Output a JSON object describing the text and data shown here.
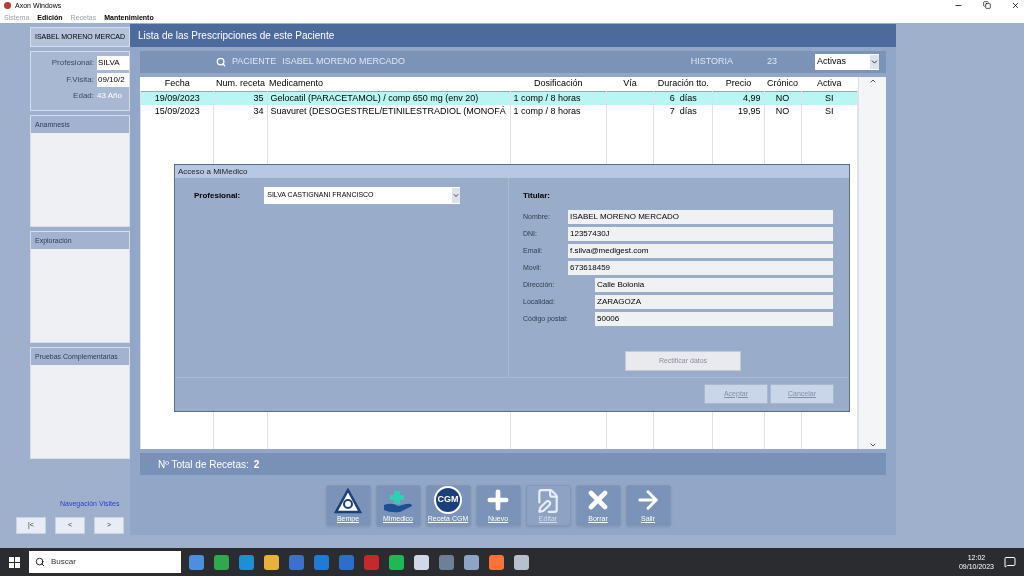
{
  "app_title": "Axon Windows",
  "menu": [
    {
      "label": "Sistema",
      "disabled": true
    },
    {
      "label": "Edición",
      "disabled": false
    },
    {
      "label": "Recetas",
      "disabled": true
    },
    {
      "label": "Mantenimiento",
      "disabled": false
    }
  ],
  "side_panel": {
    "patient": "ISABEL MORENO MERCAD",
    "fields": [
      {
        "label": "Profesional:",
        "value": "SILVA",
        "kind": "input"
      },
      {
        "label": "F.Visita:",
        "value": "09/10/2",
        "kind": "input"
      },
      {
        "label": "Edad:",
        "value": "43 Año",
        "kind": "text"
      }
    ],
    "sections": [
      "Anamnesis",
      "Exploración",
      "Pruebas Complementarias"
    ],
    "nav_label": "Navegación Visites",
    "nav_buttons": [
      "|<",
      "<",
      ">"
    ]
  },
  "window": {
    "title": "Lista de las Prescripciones de este Paciente",
    "patient_label": "PACIENTE",
    "patient_name": "ISABEL MORENO MERCADO",
    "history_label": "HISTORIA",
    "history_value": "23",
    "filter": "Activas",
    "table": {
      "columns": [
        "Fecha",
        "Num. receta",
        "Medicamento",
        "Dosificación",
        "Vía",
        "Duración tto.",
        "Precio",
        "Crónico",
        "Activa"
      ],
      "rows": [
        {
          "selected": true,
          "cells": [
            "19/09/2023",
            "35",
            "Gelocatil (PARACETAMOL) / comp 650 mg (env 20)",
            "1 comp / 8 horas",
            "",
            "6  días",
            "4,99",
            "NO",
            "SI"
          ]
        },
        {
          "selected": false,
          "cells": [
            "15/09/2023",
            "34",
            "Suavuret (DESOGESTREL/ETINILESTRADIOL (MONOFÁ",
            "1 comp / 8 horas",
            "",
            "7  días",
            "19,95",
            "NO",
            "SI"
          ]
        }
      ]
    },
    "total_label": "Nº Total de Recetas:",
    "total_value": "2",
    "toolbar": [
      {
        "label": "Bempe",
        "kind": "triangle",
        "disabled": false
      },
      {
        "label": "Mimedico",
        "kind": "hand",
        "disabled": false
      },
      {
        "label": "Receta CGM",
        "kind": "badge",
        "badge": "CGM",
        "disabled": false
      },
      {
        "label": "Nuevo",
        "kind": "plus",
        "disabled": false
      },
      {
        "label": "Editar",
        "kind": "edit",
        "disabled": true
      },
      {
        "label": "Borrar",
        "kind": "cross",
        "disabled": false
      },
      {
        "label": "Salir",
        "kind": "arrow",
        "disabled": false
      }
    ]
  },
  "dialog": {
    "title": "Acceso a MiMedico",
    "professional_label": "Profesional:",
    "professional_value": "SILVA CASTIGNANI FRANCISCO",
    "holder_label": "Titular:",
    "fields": [
      {
        "label": "Nombre:",
        "value": "ISABEL MORENO MERCADO",
        "kind": "short"
      },
      {
        "label": "DNI:",
        "value": "12357430J",
        "kind": "short"
      },
      {
        "label": "Email:",
        "value": "f.silva@medigest.com",
        "kind": "short"
      },
      {
        "label": "Movil:",
        "value": "673618459",
        "kind": "short"
      },
      {
        "label": "Dirección:",
        "value": "Calle Bolonia",
        "kind": "long"
      },
      {
        "label": "Localidad:",
        "value": "ZARAGOZA",
        "kind": "long"
      },
      {
        "label": "Código postal:",
        "value": "50006",
        "kind": "long"
      }
    ],
    "rectify": {
      "label": "Rectificar datos",
      "disabled": true
    },
    "buttons": [
      {
        "label": "Aceptar",
        "disabled": true
      },
      {
        "label": "Cancelar",
        "disabled": true
      }
    ]
  },
  "taskbar": {
    "search_placeholder": "Buscar",
    "apps": [
      {
        "color": "#4a8fe0"
      },
      {
        "color": "#2fa84f"
      },
      {
        "color": "#1d8fd8"
      },
      {
        "color": "#e8b23a"
      },
      {
        "color": "#3b6fd1"
      },
      {
        "color": "#1f7bd6"
      },
      {
        "color": "#2a6fcf"
      },
      {
        "color": "#c8272d"
      },
      {
        "color": "#1db954"
      },
      {
        "color": "#d0d8e8"
      },
      {
        "color": "#6d7f99"
      },
      {
        "color": "#8fa3c4"
      },
      {
        "color": "#ff7139"
      },
      {
        "color": "#b8c0cc"
      }
    ],
    "time": "12:02",
    "date": "09/10/2023"
  }
}
